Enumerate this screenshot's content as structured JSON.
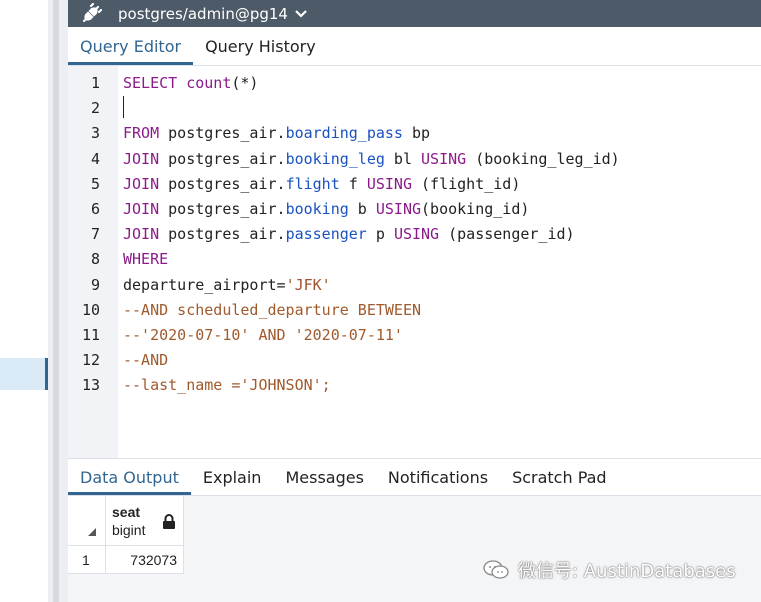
{
  "connection": {
    "label": "postgres/admin@pg14",
    "icon": "plug-icon"
  },
  "editor_tabs": [
    {
      "label": "Query Editor",
      "active": true
    },
    {
      "label": "Query History",
      "active": false
    }
  ],
  "code_lines": [
    {
      "num": "1",
      "tokens": [
        [
          "kw",
          "SELECT "
        ],
        [
          "kw",
          "count"
        ],
        [
          "plain",
          "(*)"
        ]
      ]
    },
    {
      "num": "2",
      "tokens": []
    },
    {
      "num": "3",
      "tokens": [
        [
          "kw",
          "FROM "
        ],
        [
          "plain",
          "postgres_air."
        ],
        [
          "prop",
          "boarding_pass"
        ],
        [
          "plain",
          " bp"
        ]
      ]
    },
    {
      "num": "4",
      "tokens": [
        [
          "kw",
          "JOIN "
        ],
        [
          "plain",
          "postgres_air."
        ],
        [
          "prop",
          "booking_leg"
        ],
        [
          "plain",
          " bl "
        ],
        [
          "kw",
          "USING"
        ],
        [
          "plain",
          " (booking_leg_id)"
        ]
      ]
    },
    {
      "num": "5",
      "tokens": [
        [
          "kw",
          "JOIN "
        ],
        [
          "plain",
          "postgres_air."
        ],
        [
          "prop",
          "flight"
        ],
        [
          "plain",
          " f "
        ],
        [
          "kw",
          "USING"
        ],
        [
          "plain",
          " (flight_id)"
        ]
      ]
    },
    {
      "num": "6",
      "tokens": [
        [
          "kw",
          "JOIN "
        ],
        [
          "plain",
          "postgres_air."
        ],
        [
          "prop",
          "booking"
        ],
        [
          "plain",
          " b "
        ],
        [
          "kw",
          "USING"
        ],
        [
          "plain",
          "(booking_id)"
        ]
      ]
    },
    {
      "num": "7",
      "tokens": [
        [
          "kw",
          "JOIN "
        ],
        [
          "plain",
          "postgres_air."
        ],
        [
          "prop",
          "passenger"
        ],
        [
          "plain",
          " p "
        ],
        [
          "kw",
          "USING"
        ],
        [
          "plain",
          " (passenger_id)"
        ]
      ]
    },
    {
      "num": "8",
      "tokens": [
        [
          "kw",
          "WHERE"
        ]
      ]
    },
    {
      "num": "9",
      "tokens": [
        [
          "plain",
          "departure_airport="
        ],
        [
          "str",
          "'JFK'"
        ]
      ]
    },
    {
      "num": "10",
      "tokens": [
        [
          "cmt",
          "--AND scheduled_departure BETWEEN"
        ]
      ]
    },
    {
      "num": "11",
      "tokens": [
        [
          "cmt",
          "--'2020-07-10' AND '2020-07-11'"
        ]
      ]
    },
    {
      "num": "12",
      "tokens": [
        [
          "cmt",
          "--AND"
        ]
      ]
    },
    {
      "num": "13",
      "tokens": [
        [
          "cmt",
          "--last_name ='JOHNSON';"
        ]
      ]
    }
  ],
  "result_tabs": [
    {
      "label": "Data Output",
      "active": true
    },
    {
      "label": "Explain",
      "active": false
    },
    {
      "label": "Messages",
      "active": false
    },
    {
      "label": "Notifications",
      "active": false
    },
    {
      "label": "Scratch Pad",
      "active": false
    }
  ],
  "grid": {
    "column": {
      "name": "seat",
      "type": "bigint",
      "locked": true
    },
    "rows": [
      {
        "num": "1",
        "value": "732073"
      }
    ]
  },
  "watermark": {
    "text": "微信号: AustinDatabases"
  },
  "colors": {
    "accent": "#326690",
    "keyword": "#8b1a8b",
    "property": "#1a52c0",
    "string": "#a0522d",
    "header_bar": "#4d5a68"
  }
}
